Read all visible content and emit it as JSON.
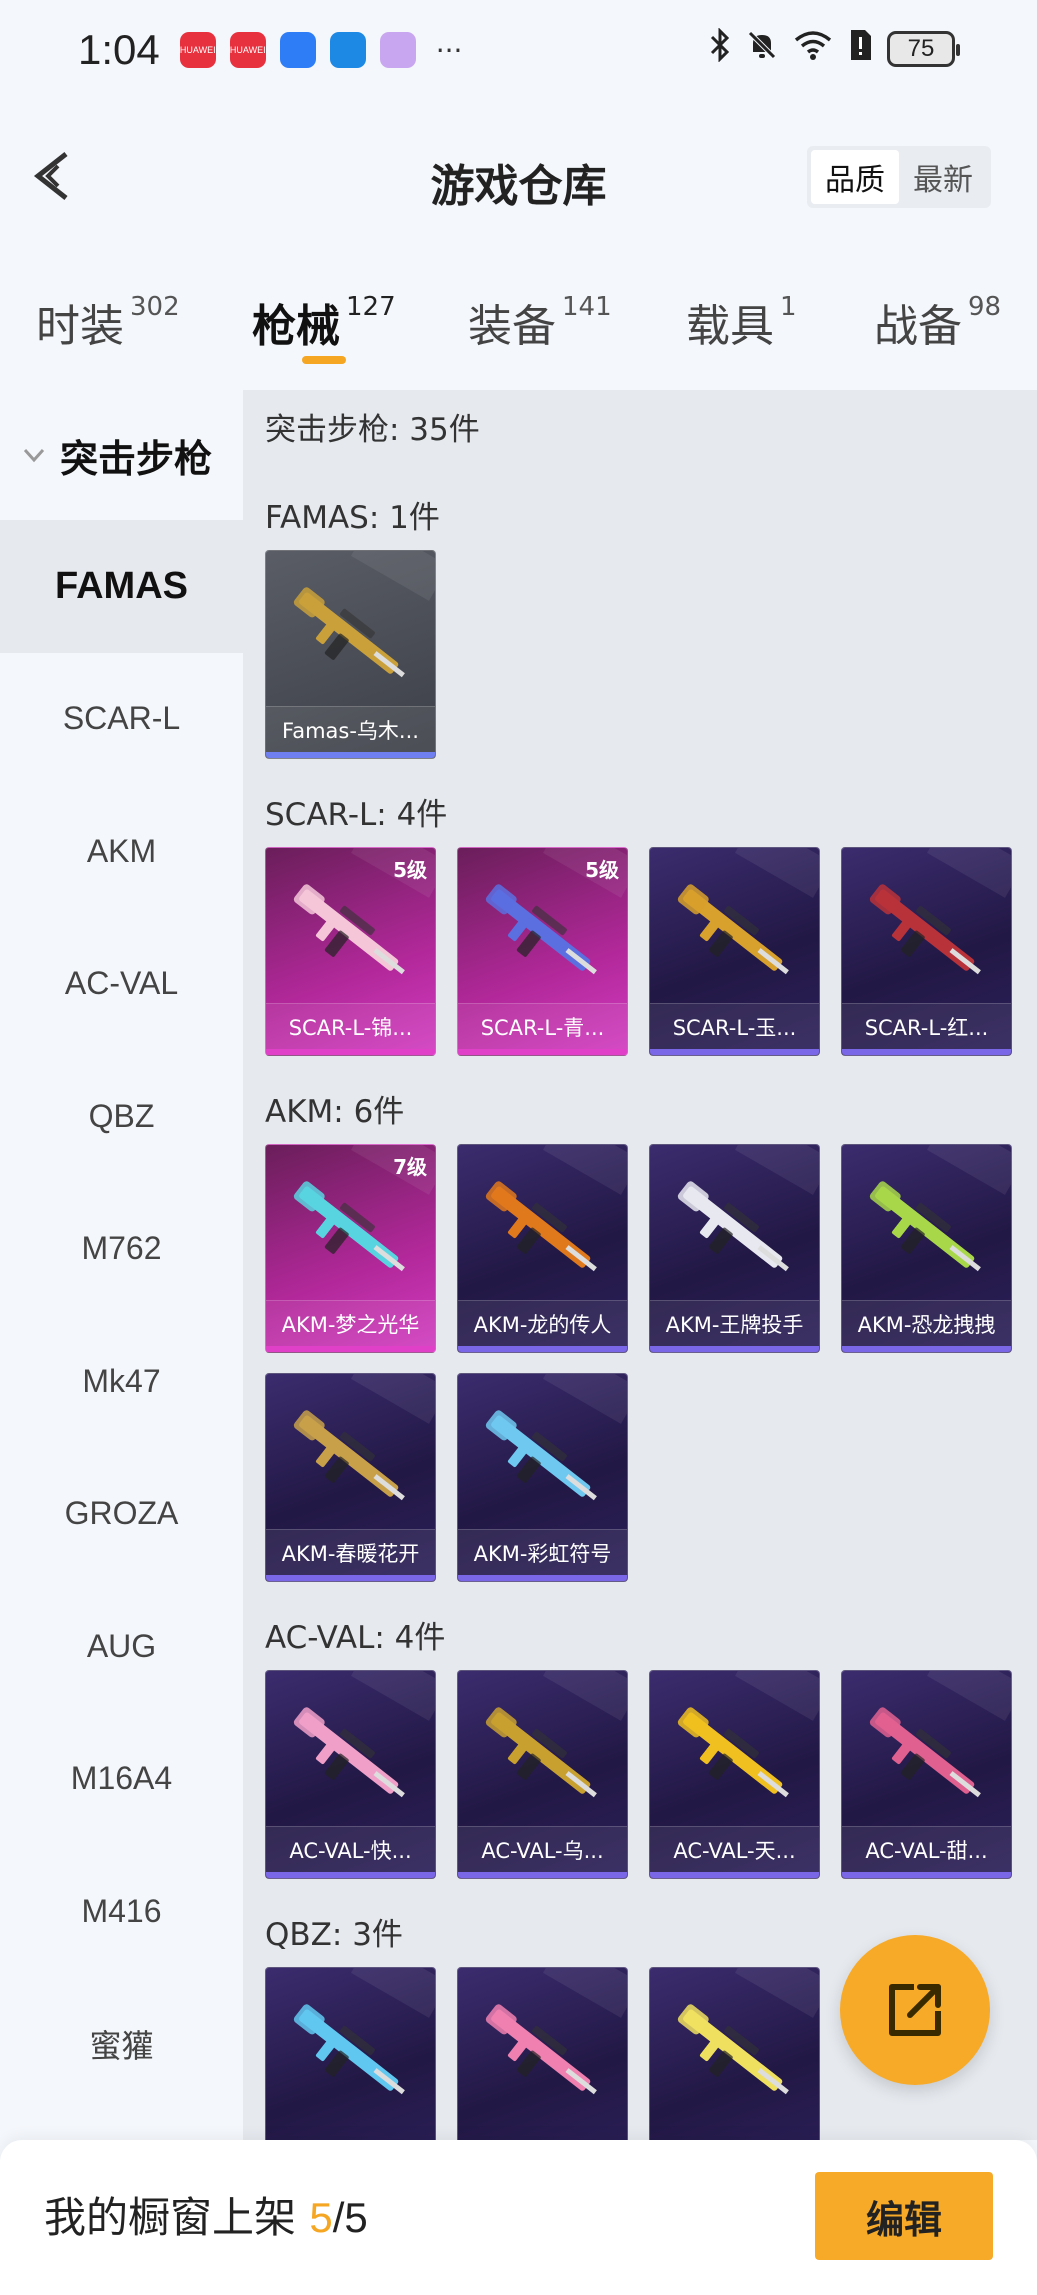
{
  "status_bar": {
    "time": "1:04",
    "apps": [
      {
        "icon": "huawei-app-icon",
        "label": "HUAWEI",
        "color": "#e8313e"
      },
      {
        "icon": "huawei-app-icon",
        "label": "HUAWEI",
        "color": "#e8313e"
      },
      {
        "icon": "bluetooth-app-icon",
        "label": "",
        "color": "#2f7df6"
      },
      {
        "icon": "weather-app-icon",
        "label": "",
        "color": "#1e88e5"
      },
      {
        "icon": "assistant-app-icon",
        "label": "",
        "color": "#c9a6f0"
      }
    ],
    "more": "···",
    "battery": "75"
  },
  "header": {
    "title": "游戏仓库",
    "sort_options": [
      "品质",
      "最新"
    ],
    "sort_active": "品质"
  },
  "tabs": [
    {
      "label": "时装",
      "count": "302"
    },
    {
      "label": "枪械",
      "count": "127",
      "active": true
    },
    {
      "label": "装备",
      "count": "141"
    },
    {
      "label": "载具",
      "count": "1"
    },
    {
      "label": "战备",
      "count": "98"
    }
  ],
  "sidebar": {
    "section": "突击步枪",
    "items": [
      "FAMAS",
      "SCAR-L",
      "AKM",
      "AC-VAL",
      "QBZ",
      "M762",
      "Mk47",
      "GROZA",
      "AUG",
      "M16A4",
      "M416",
      "蜜獾"
    ],
    "active": "FAMAS"
  },
  "main": {
    "category_title": "突击步枪: 35件",
    "groups": [
      {
        "title": "FAMAS: 1件",
        "items": [
          {
            "name": "Famas-乌木...",
            "rarity": "gray",
            "level": "",
            "gun_color": "#c9a03a"
          }
        ]
      },
      {
        "title": "SCAR-L: 4件",
        "items": [
          {
            "name": "SCAR-L-锦...",
            "rarity": "magenta",
            "level": "5级",
            "gun_color": "#f4c6d8"
          },
          {
            "name": "SCAR-L-青...",
            "rarity": "magenta",
            "level": "5级",
            "gun_color": "#5b6fe0"
          },
          {
            "name": "SCAR-L-玉...",
            "rarity": "purple",
            "level": "",
            "gun_color": "#d8a02c"
          },
          {
            "name": "SCAR-L-红...",
            "rarity": "purple",
            "level": "",
            "gun_color": "#b8323a"
          }
        ]
      },
      {
        "title": "AKM: 6件",
        "items": [
          {
            "name": "AKM-梦之光华",
            "rarity": "magenta",
            "level": "7级",
            "gun_color": "#58d4e0"
          },
          {
            "name": "AKM-龙的传人",
            "rarity": "purple",
            "level": "",
            "gun_color": "#e0781c"
          },
          {
            "name": "AKM-王牌投手",
            "rarity": "purple",
            "level": "",
            "gun_color": "#e8e8f0"
          },
          {
            "name": "AKM-恐龙拽拽",
            "rarity": "purple",
            "level": "",
            "gun_color": "#a8d84a"
          },
          {
            "name": "AKM-春暖花开",
            "rarity": "purple",
            "level": "",
            "gun_color": "#c8a04a"
          },
          {
            "name": "AKM-彩虹符号",
            "rarity": "purple",
            "level": "",
            "gun_color": "#6ec8f0"
          }
        ]
      },
      {
        "title": "AC-VAL: 4件",
        "items": [
          {
            "name": "AC-VAL-快...",
            "rarity": "purple",
            "level": "",
            "gun_color": "#f0a0c8"
          },
          {
            "name": "AC-VAL-乌...",
            "rarity": "purple",
            "level": "",
            "gun_color": "#c8a030"
          },
          {
            "name": "AC-VAL-天...",
            "rarity": "purple",
            "level": "",
            "gun_color": "#f0c020"
          },
          {
            "name": "AC-VAL-甜...",
            "rarity": "purple",
            "level": "",
            "gun_color": "#e06090"
          }
        ]
      },
      {
        "title": "QBZ: 3件",
        "items": [
          {
            "name": "",
            "rarity": "purple",
            "level": "",
            "gun_color": "#60c8f0"
          },
          {
            "name": "",
            "rarity": "purple",
            "level": "",
            "gun_color": "#f080b0"
          },
          {
            "name": "",
            "rarity": "purple",
            "level": "",
            "gun_color": "#f0e060"
          }
        ]
      }
    ]
  },
  "fab": {
    "icon": "share-out-icon"
  },
  "bottom_bar": {
    "label": "我的橱窗上架 ",
    "used": "5",
    "separator": "/",
    "total": "5",
    "edit_label": "编辑"
  },
  "colors": {
    "accent": "#f5a623",
    "card_purple": "#2a1f55",
    "card_magenta": "#b2289a"
  }
}
